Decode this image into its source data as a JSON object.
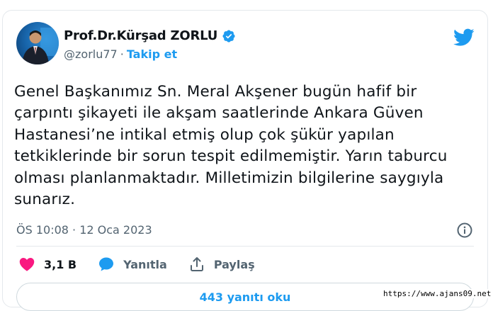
{
  "author": {
    "display_name": "Prof.Dr.Kürşad ZORLU",
    "handle": "@zorlu77",
    "separator": "·",
    "follow_label": "Takip et"
  },
  "tweet": {
    "text": "Genel Başkanımız Sn. Meral Akşener bugün hafif bir çarpıntı şikayeti ile akşam saatlerinde Ankara Güven Hastanesi’ne intikal etmiş olup çok şükür yapılan tetkiklerinde bir sorun tespit edilmemiştir. Yarın taburcu olması planlanmaktadır. Milletimizin bilgilerine saygıyla sunarız.",
    "timestamp": "ÖS 10:08 · 12 Oca 2023"
  },
  "actions": {
    "like_count": "3,1 B",
    "reply_label": "Yanıtla",
    "share_label": "Paylaş"
  },
  "replies_button": "443 yanıtı oku",
  "watermark": "https://www.ajans09.net",
  "colors": {
    "accent": "#1d9bf0",
    "like": "#f91880",
    "muted": "#536471",
    "text": "#0f1419"
  },
  "icons": [
    "verified-badge-icon",
    "twitter-bird-icon",
    "info-icon",
    "heart-icon",
    "reply-bubble-icon",
    "share-icon"
  ]
}
